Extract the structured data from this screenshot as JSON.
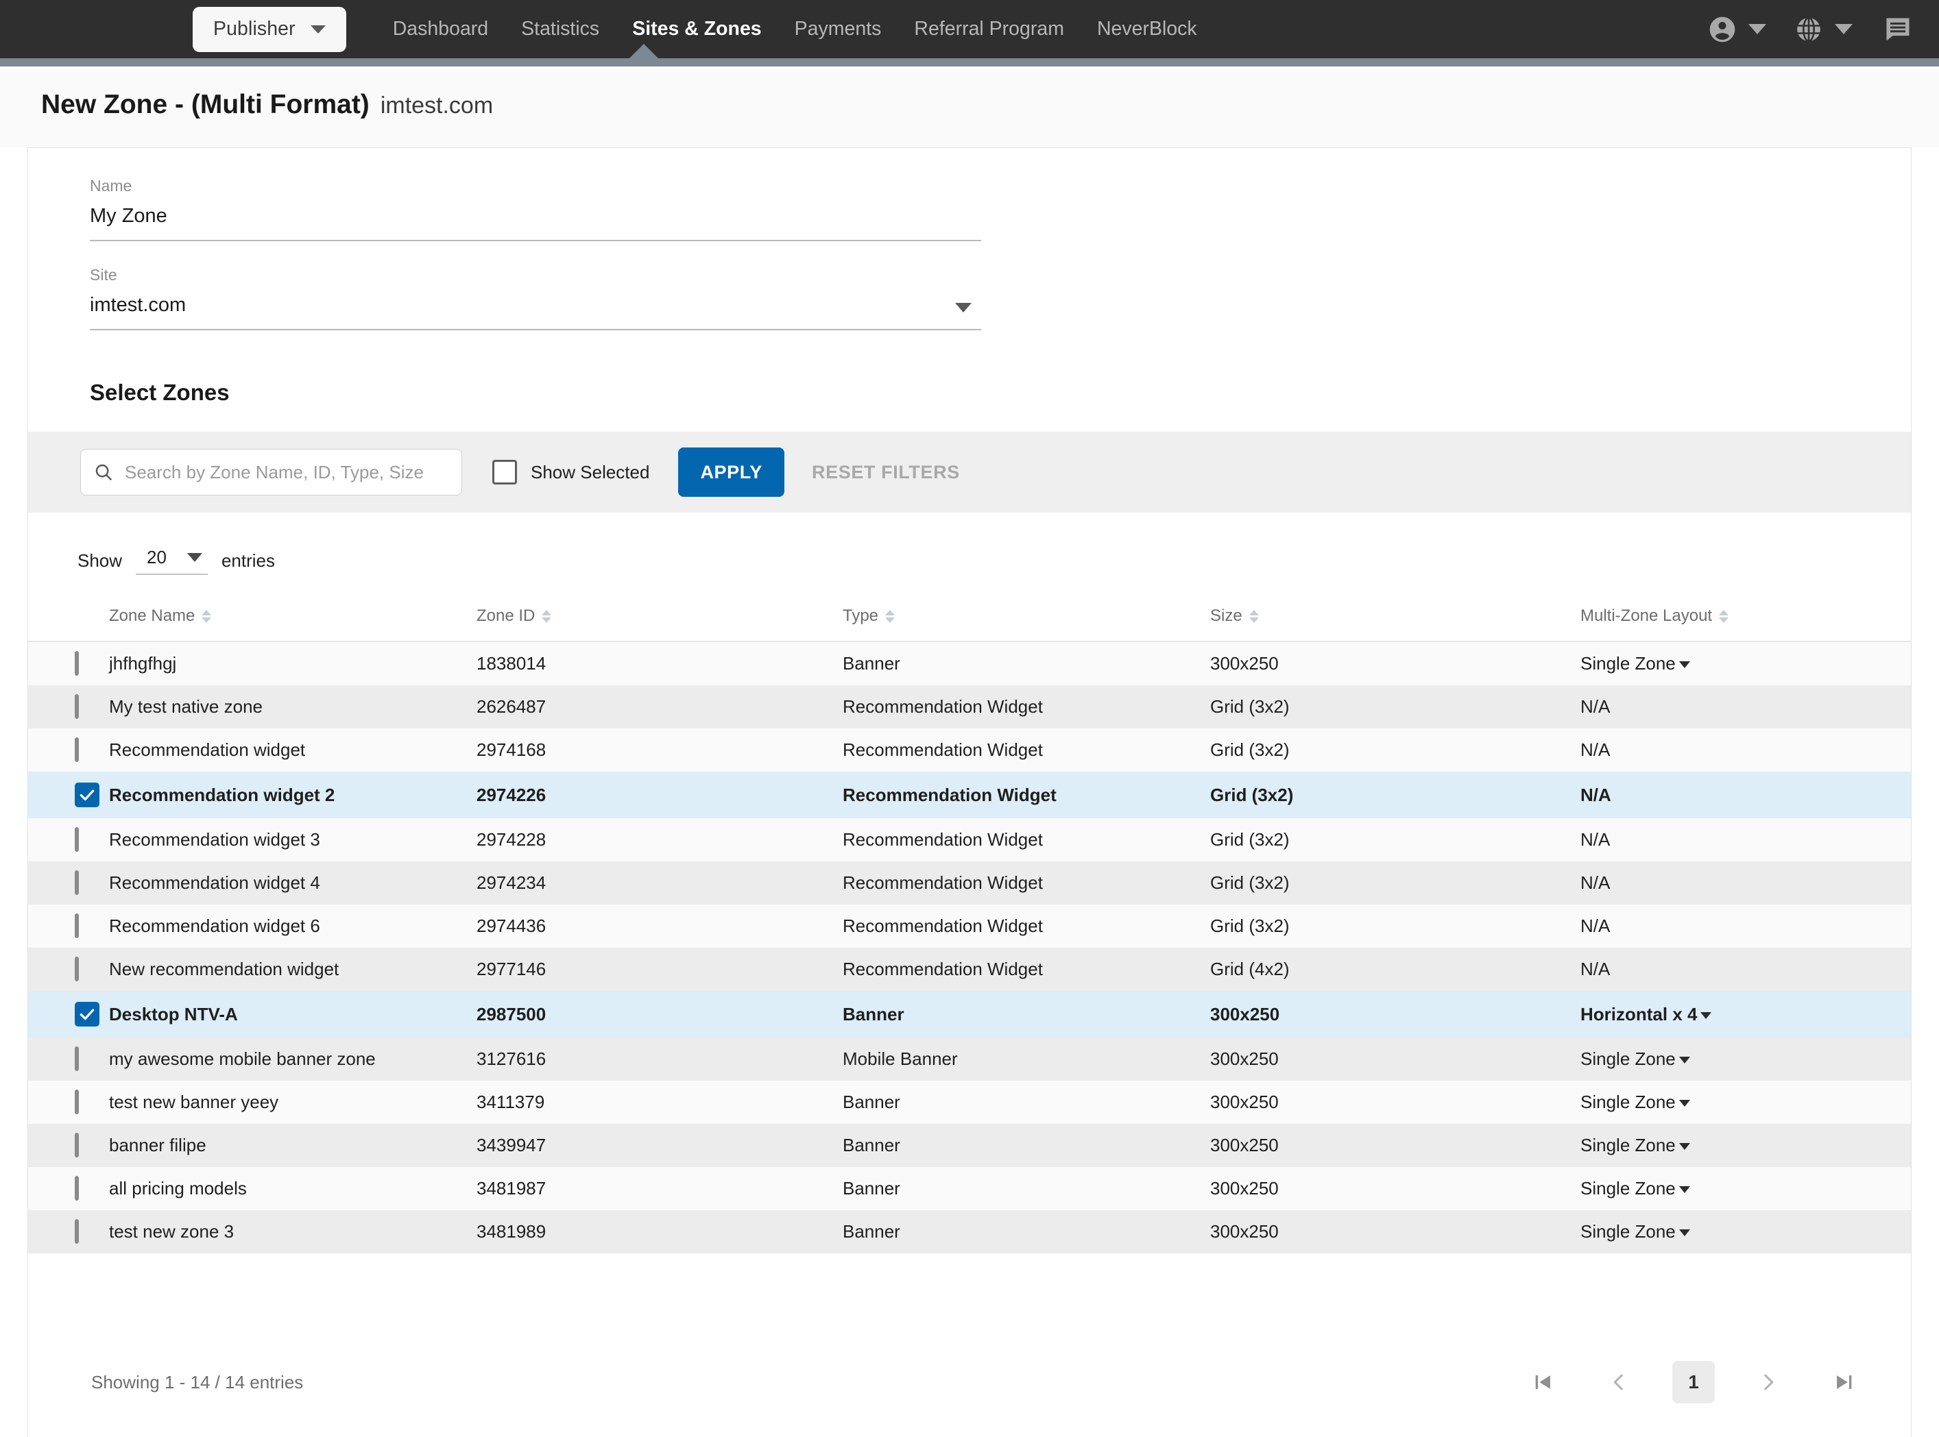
{
  "nav": {
    "publisher_label": "Publisher",
    "items": [
      {
        "label": "Dashboard",
        "active": false
      },
      {
        "label": "Statistics",
        "active": false
      },
      {
        "label": "Sites & Zones",
        "active": true
      },
      {
        "label": "Payments",
        "active": false
      },
      {
        "label": "Referral Program",
        "active": false
      },
      {
        "label": "NeverBlock",
        "active": false
      }
    ],
    "icons": [
      "account-circle-icon",
      "chevron-down-icon",
      "globe-icon",
      "chevron-down-icon",
      "message-icon"
    ]
  },
  "header": {
    "title": "New Zone - (Multi Format)",
    "site": "imtest.com"
  },
  "form": {
    "name_label": "Name",
    "name_value": "My Zone",
    "site_label": "Site",
    "site_value": "imtest.com"
  },
  "select_zones": {
    "title": "Select Zones",
    "search_placeholder": "Search by Zone Name, ID, Type, Size",
    "search_value": "",
    "show_selected_label": "Show Selected",
    "show_selected_checked": false,
    "apply_label": "APPLY",
    "reset_label": "RESET FILTERS",
    "show_label": "Show",
    "entries_value": "20",
    "entries_label": "entries"
  },
  "table": {
    "columns": [
      "Zone Name",
      "Zone ID",
      "Type",
      "Size",
      "Multi-Zone Layout"
    ],
    "rows": [
      {
        "checked": false,
        "name": "jhfhgfhgj",
        "id": "1838014",
        "type": "Banner",
        "size": "300x250",
        "layout": "Single Zone",
        "layout_caret": true
      },
      {
        "checked": false,
        "name": "My test native zone",
        "id": "2626487",
        "type": "Recommendation Widget",
        "size": "Grid (3x2)",
        "layout": "N/A",
        "layout_caret": false
      },
      {
        "checked": false,
        "name": "Recommendation widget",
        "id": "2974168",
        "type": "Recommendation Widget",
        "size": "Grid (3x2)",
        "layout": "N/A",
        "layout_caret": false
      },
      {
        "checked": true,
        "name": "Recommendation widget 2",
        "id": "2974226",
        "type": "Recommendation Widget",
        "size": "Grid (3x2)",
        "layout": "N/A",
        "layout_caret": false
      },
      {
        "checked": false,
        "name": "Recommendation widget 3",
        "id": "2974228",
        "type": "Recommendation Widget",
        "size": "Grid (3x2)",
        "layout": "N/A",
        "layout_caret": false
      },
      {
        "checked": false,
        "name": "Recommendation widget 4",
        "id": "2974234",
        "type": "Recommendation Widget",
        "size": "Grid (3x2)",
        "layout": "N/A",
        "layout_caret": false
      },
      {
        "checked": false,
        "name": "Recommendation widget 6",
        "id": "2974436",
        "type": "Recommendation Widget",
        "size": "Grid (3x2)",
        "layout": "N/A",
        "layout_caret": false
      },
      {
        "checked": false,
        "name": "New recommendation widget",
        "id": "2977146",
        "type": "Recommendation Widget",
        "size": "Grid (4x2)",
        "layout": "N/A",
        "layout_caret": false
      },
      {
        "checked": true,
        "name": "Desktop NTV-A",
        "id": "2987500",
        "type": "Banner",
        "size": "300x250",
        "layout": "Horizontal x 4",
        "layout_caret": true
      },
      {
        "checked": false,
        "name": "my awesome mobile banner zone",
        "id": "3127616",
        "type": "Mobile Banner",
        "size": "300x250",
        "layout": "Single Zone",
        "layout_caret": true
      },
      {
        "checked": false,
        "name": "test new banner yeey",
        "id": "3411379",
        "type": "Banner",
        "size": "300x250",
        "layout": "Single Zone",
        "layout_caret": true
      },
      {
        "checked": false,
        "name": "banner filipe",
        "id": "3439947",
        "type": "Banner",
        "size": "300x250",
        "layout": "Single Zone",
        "layout_caret": true
      },
      {
        "checked": false,
        "name": "all pricing models",
        "id": "3481987",
        "type": "Banner",
        "size": "300x250",
        "layout": "Single Zone",
        "layout_caret": true
      },
      {
        "checked": false,
        "name": "test new zone 3",
        "id": "3481989",
        "type": "Banner",
        "size": "300x250",
        "layout": "Single Zone",
        "layout_caret": true
      }
    ]
  },
  "footer": {
    "showing": "Showing 1 - 14 / 14 entries",
    "page_current": "1",
    "pager_icons": [
      "first-page-icon",
      "previous-page-icon",
      "next-page-icon",
      "last-page-icon"
    ]
  },
  "colors": {
    "nav_bg": "#2f2f2f",
    "nav_separator": "#7c8894",
    "accent_blue": "#0566b0",
    "selected_row": "#ddeef8"
  }
}
